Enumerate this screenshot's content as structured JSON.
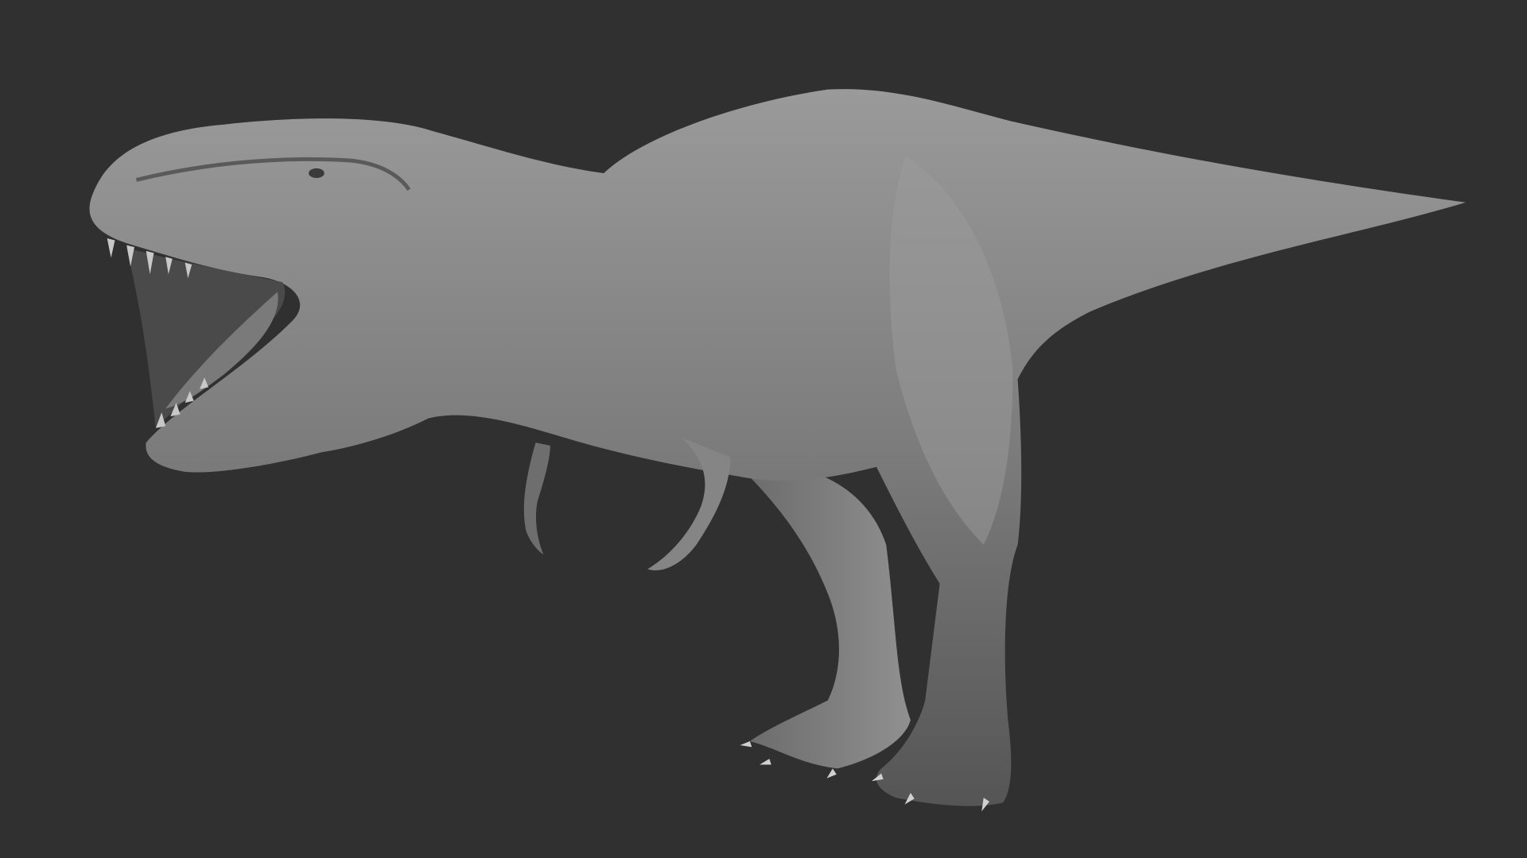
{
  "scene": {
    "subject": "t-rex-sculpt",
    "background_color": "#303030",
    "model_color": "#8a8a8a"
  }
}
